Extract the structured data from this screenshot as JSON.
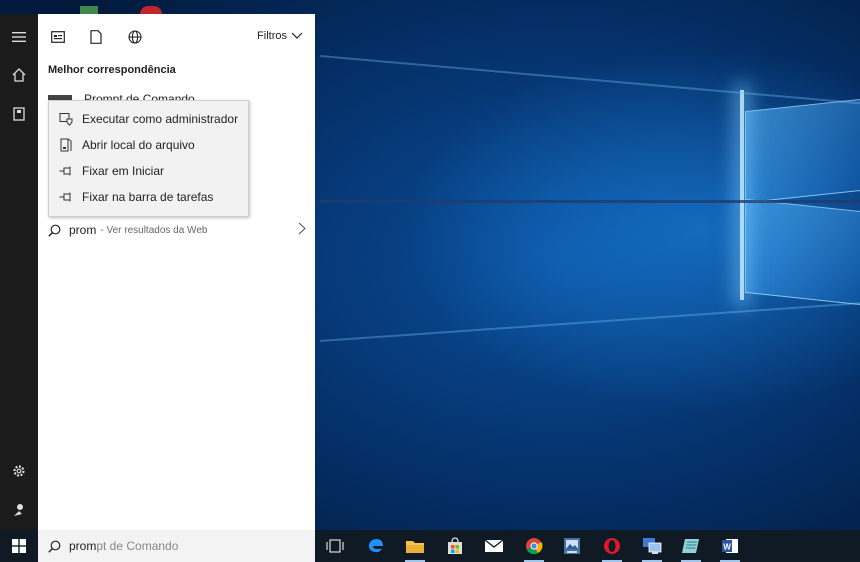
{
  "start_menu": {
    "rail": {
      "menu_icon": "hamburger-icon",
      "home_icon": "home-icon",
      "docs_icon": "notebook-icon",
      "settings_icon": "gear-icon",
      "user_icon": "user-icon"
    },
    "toolbar": {
      "apps_icon": "apps-icon",
      "documents_icon": "document-icon",
      "web_icon": "globe-icon",
      "filters_label": "Filtros"
    },
    "best_match_heading": "Melhor correspondência",
    "best_match_app": "Prompt de Comando",
    "web_result": {
      "query": "prom",
      "hint": "- Ver resultados da Web"
    }
  },
  "context_menu": {
    "items": [
      {
        "label": "Executar como administrador",
        "icon": "shield-run-icon"
      },
      {
        "label": "Abrir local do arquivo",
        "icon": "folder-open-icon"
      },
      {
        "label": "Fixar em Iniciar",
        "icon": "pin-icon"
      },
      {
        "label": "Fixar na barra de tarefas",
        "icon": "pin-icon"
      }
    ]
  },
  "taskbar": {
    "search_typed": "prom",
    "search_suggestion": "pt de Comando",
    "apps": [
      {
        "name": "task-view-icon"
      },
      {
        "name": "edge-icon"
      },
      {
        "name": "file-explorer-icon"
      },
      {
        "name": "store-icon"
      },
      {
        "name": "mail-icon"
      },
      {
        "name": "chrome-icon"
      },
      {
        "name": "photo-app-icon"
      },
      {
        "name": "opera-icon"
      },
      {
        "name": "remote-desktop-icon"
      },
      {
        "name": "notes-app-icon"
      },
      {
        "name": "word-icon"
      }
    ]
  },
  "colors": {
    "accent": "#0078d7",
    "taskbar": "#0f1a24",
    "rail": "#1b1b1b"
  }
}
